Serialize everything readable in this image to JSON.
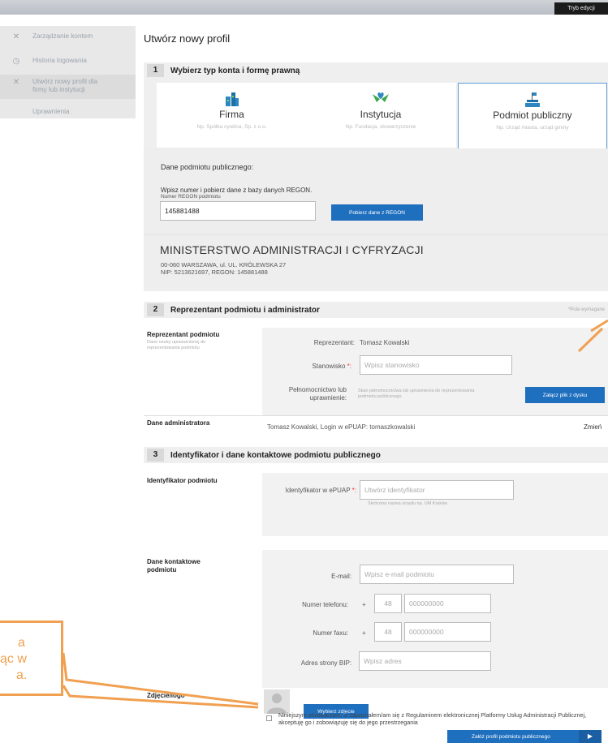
{
  "topbar": {
    "edit_mode": "Tryb edycji"
  },
  "sidebar": {
    "items": [
      {
        "label": "Zarządzanie kontem",
        "icon": "tools-icon"
      },
      {
        "label": "Historia logowania",
        "icon": "clock-icon"
      },
      {
        "label": "Utwórz nowy profil dla firmy lub instytucji",
        "icon": "tools-icon"
      },
      {
        "label": "Uprawnienia",
        "icon": ""
      }
    ]
  },
  "page_title": "Utwórz nowy profil",
  "section1": {
    "number": "1",
    "title": "Wybierz typ konta i formę prawną",
    "cards": [
      {
        "title": "Firma",
        "subtitle": "Np. Spółka cywilna, Sp. z o.o.",
        "icon": "buildings-icon"
      },
      {
        "title": "Instytucja",
        "subtitle": "Np. Fundacja, stowarzyszenie",
        "icon": "hands-heart-icon"
      },
      {
        "title": "Podmiot publiczny",
        "subtitle": "Np. Urząd miasta, urząd gminy",
        "icon": "government-icon"
      }
    ],
    "public_data_label": "Dane podmiotu publicznego:",
    "regon_instruction": "Wpisz numer i pobierz dane z bazy danych REGON.",
    "regon_field_label": "Numer REGON podmiotu",
    "regon_value": "145881488",
    "fetch_button": "Pobierz dane z REGON",
    "org_name": "MINISTERSTWO ADMINISTRACJI I CYFRYZACJI",
    "org_address": "00-060 WARSZAWA, ul. UL. KRÓLEWSKA 27",
    "org_ids": "NIP: 5213621697, REGON: 145881488"
  },
  "section2": {
    "number": "2",
    "title": "Reprezentant podmiotu i administrator",
    "required_note": "*Pola wymagane",
    "rep_label": "Reprezentant podmiotu",
    "rep_desc": "Dane osoby upoważnionej do reprezentowania podmiotu",
    "rep_key": "Reprezentant:",
    "rep_value": "Tomasz Kowalski",
    "position_label": "Stanowisko",
    "position_placeholder": "Wpisz stanowisko",
    "authorization_label": "Pełnomocnictwo lub uprawnienie:",
    "authorization_desc": "Skan pełnomocnictwa lub uprawnienia do reprezentowania podmiotu publicznego",
    "attach_button": "Załącz plik z dysku",
    "admin_label": "Dane administratora",
    "admin_value": "Tomasz Kowalski, Login w ePUAP: tomaszkowalski",
    "change_link": "Zmień"
  },
  "section3": {
    "number": "3",
    "title": "Identyfikator i dane kontaktowe podmiotu publicznego",
    "identifier_label": "Identyfikator podmiotu",
    "epuap_label": "Identyfikator w ePUAP",
    "epuap_placeholder": "Utwórz identyfikator",
    "epuap_hint": "Skrócona nazwa urzędu np. UM Kraków",
    "contact_label": "Dane kontaktowe podmiotu",
    "email_label": "E-mail:",
    "email_placeholder": "Wpisz e-mail podmiotu",
    "phone_label": "Numer telefonu:",
    "fax_label": "Numer faxu:",
    "plus_sign": "+",
    "country_code": "48",
    "number_placeholder": "000000000",
    "bip_label": "Adres strony BIP:",
    "bip_placeholder": "Wpisz adres",
    "photo_label": "Zdjęcie/logo",
    "photo_button": "Wybierz zdjęcie",
    "consent_text": "Niniejszym oświadczam, iż zapoznałem/am się z Regulaminem elektronicznej Platformy Usług Administracji Publicznej, akceptuję go i zobowiązuję się do jego przestrzegania",
    "submit_button": "Załóż profil podmiotu publicznego"
  },
  "callout": {
    "lines": [
      "a",
      "ąc w",
      "a."
    ]
  },
  "colors": {
    "accent": "#1f6fbf",
    "callout": "#f0a050",
    "card_border": "#5b9bd5"
  }
}
